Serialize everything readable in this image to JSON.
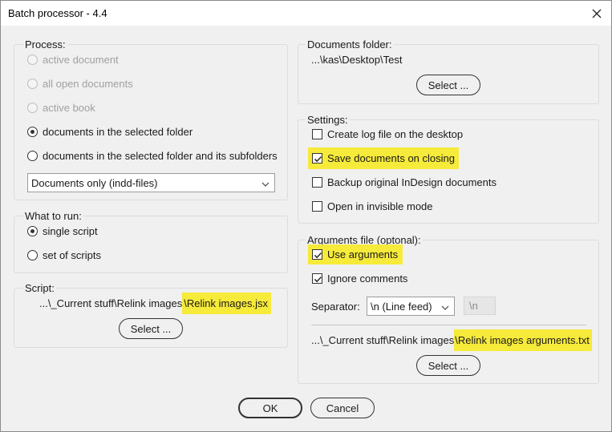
{
  "window": {
    "title": "Batch processor - 4.4"
  },
  "process": {
    "title": "Process:",
    "options": [
      {
        "label": "active document",
        "enabled": false,
        "selected": false
      },
      {
        "label": "all open documents",
        "enabled": false,
        "selected": false
      },
      {
        "label": "active book",
        "enabled": false,
        "selected": false
      },
      {
        "label": "documents in the selected folder",
        "enabled": true,
        "selected": true
      },
      {
        "label": "documents in the selected folder and its subfolders",
        "enabled": true,
        "selected": false
      }
    ],
    "filter_value": "Documents only (indd-files)"
  },
  "what_to_run": {
    "title": "What to run:",
    "options": [
      {
        "label": "single script",
        "selected": true
      },
      {
        "label": "set of scripts",
        "selected": false
      }
    ]
  },
  "script": {
    "title": "Script:",
    "path_prefix": "...\\_Current stuff\\Relink images",
    "path_file": "\\Relink images.jsx",
    "select_label": "Select ..."
  },
  "documents_folder": {
    "title": "Documents folder:",
    "path": "...\\kas\\Desktop\\Test",
    "select_label": "Select ..."
  },
  "settings": {
    "title": "Settings:",
    "options": [
      {
        "label": "Create log file on the desktop",
        "checked": false
      },
      {
        "label": "Save documents on closing",
        "checked": true
      },
      {
        "label": "Backup original InDesign documents",
        "checked": false
      },
      {
        "label": "Open in invisible mode",
        "checked": false
      }
    ]
  },
  "arguments": {
    "title": "Arguments file (optonal):",
    "use_label": "Use arguments",
    "use_checked": true,
    "ignore_label": "Ignore comments",
    "ignore_checked": true,
    "separator_label": "Separator:",
    "separator_value": "\\n (Line feed)",
    "separator_custom": "\\n",
    "path_prefix": "...\\_Current stuff\\Relink images",
    "path_file": "\\Relink images arguments.txt",
    "select_label": "Select ..."
  },
  "footer": {
    "ok_label": "OK",
    "cancel_label": "Cancel"
  },
  "colors": {
    "highlight": "#f6ea3a",
    "background": "#f0f0f0"
  }
}
